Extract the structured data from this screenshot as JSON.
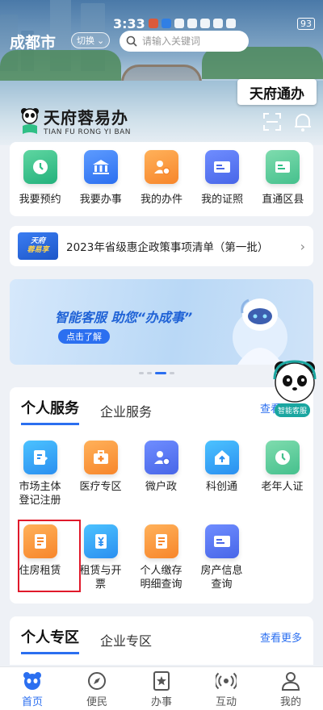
{
  "status_bar": {
    "time": "3:33",
    "battery": "93"
  },
  "header": {
    "city": "成都市",
    "switch_label": "切换",
    "search_placeholder": "请输入关键词",
    "brand_badge": "天府通办",
    "app_name": "天府蓉易办",
    "app_name_pinyin": "TIAN FU RONG YI BAN"
  },
  "quick_actions": [
    {
      "label": "我要预约",
      "icon": "clock-icon",
      "color": "#2fbf86"
    },
    {
      "label": "我要办事",
      "icon": "bank-icon",
      "color": "#2b6ff0"
    },
    {
      "label": "我的办件",
      "icon": "user-doc-icon",
      "color": "#f7862b"
    },
    {
      "label": "我的证照",
      "icon": "id-card-icon",
      "color": "#4866e8"
    },
    {
      "label": "直通区县",
      "icon": "card-icon",
      "color": "#23b17c"
    }
  ],
  "notice": {
    "tag_line1": "天府",
    "tag_line2": "蓉易享",
    "text": "2023年省级惠企政策事项清单（第一批）"
  },
  "banner": {
    "title": "智能客服 助您“办成事”",
    "button": "点击了解",
    "page_count": 4,
    "active_page": 2
  },
  "services": {
    "tabs": [
      "个人服务",
      "企业服务"
    ],
    "more": "查看更多",
    "items": [
      {
        "label_line1": "市场主体",
        "label_line2": "登记注册",
        "icon": "edit-doc-icon",
        "color": "#2a8ff0"
      },
      {
        "label_line1": "医疗专区",
        "label_line2": "",
        "icon": "medical-kit-icon",
        "color": "#f7862b"
      },
      {
        "label_line1": "微户政",
        "label_line2": "",
        "icon": "user-doc-icon",
        "color": "#4866e8"
      },
      {
        "label_line1": "科创通",
        "label_line2": "",
        "icon": "house-icon",
        "color": "#2a8ff0"
      },
      {
        "label_line1": "老年人证",
        "label_line2": "",
        "icon": "clock-icon",
        "color": "#45c08d"
      },
      {
        "label_line1": "住房租赁",
        "label_line2": "",
        "icon": "receipt-icon",
        "color": "#f7862b"
      },
      {
        "label_line1": "租赁与开",
        "label_line2": "票",
        "icon": "yuan-doc-icon",
        "color": "#2a8ff0"
      },
      {
        "label_line1": "个人缴存",
        "label_line2": "明细查询",
        "icon": "receipt-icon",
        "color": "#f7862b"
      },
      {
        "label_line1": "房产信息",
        "label_line2": "查询",
        "icon": "id-card-icon",
        "color": "#4866e8"
      }
    ]
  },
  "zone": {
    "tabs": [
      "个人专区",
      "企业专区"
    ],
    "more": "查看更多"
  },
  "customer_service_label": "智能客服",
  "bottom_nav": [
    {
      "label": "首页",
      "icon": "panda-home-icon",
      "active": true
    },
    {
      "label": "便民",
      "icon": "compass-icon",
      "active": false
    },
    {
      "label": "办事",
      "icon": "star-doc-icon",
      "active": false
    },
    {
      "label": "互动",
      "icon": "broadcast-icon",
      "active": false
    },
    {
      "label": "我的",
      "icon": "person-icon",
      "active": false
    }
  ]
}
